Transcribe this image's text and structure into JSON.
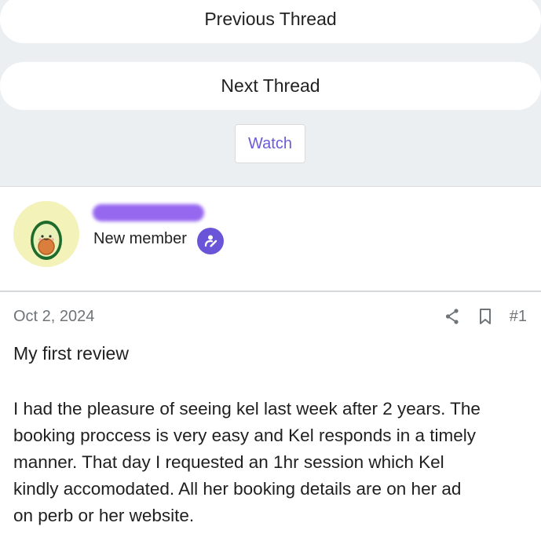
{
  "navigation": {
    "previous_label": "Previous Thread",
    "next_label": "Next Thread",
    "watch_label": "Watch"
  },
  "colors": {
    "accent": "#6b5bd6",
    "badge": "#6a55d8",
    "redaction": "#8b57ee",
    "page_background": "#eceff1"
  },
  "user": {
    "avatar_icon": "avocado-avatar",
    "role": "New member",
    "badge_icon": "new-member-badge-icon"
  },
  "post": {
    "date": "Oct 2, 2024",
    "number": "#1",
    "title": "My first review",
    "body_lines": [
      "I had the pleasure of seeing kel last week after 2 years. The",
      "booking proccess is very easy and Kel responds in a timely",
      "manner. That day I requested an 1hr session which Kel",
      "kindly accomodated. All her booking details are on her ad",
      "on perb or her website."
    ]
  }
}
